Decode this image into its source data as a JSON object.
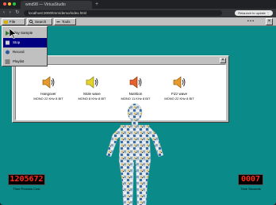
{
  "browser": {
    "tab_title": "wind98 — VirtuaStudio",
    "new_tab": "+",
    "nav": "‹ › ↻",
    "url": "localhost:3000/tmm/demo/index.html",
    "relaunch_label": "Relaunch to update ⋮",
    "window_dots": [
      "#ff5f57",
      "#febc2e",
      "#28c840"
    ]
  },
  "toolbar": {
    "items": [
      {
        "label": "File"
      },
      {
        "label": "Search"
      },
      {
        "label": "Tools"
      }
    ],
    "dots": "• • •",
    "close": "×"
  },
  "menu": {
    "items": [
      {
        "label": "Play Sample",
        "selected": false
      },
      {
        "label": "Stop",
        "selected": true
      },
      {
        "label": "Record",
        "selected": false
      },
      {
        "label": "Playlist",
        "selected": false
      }
    ]
  },
  "dialog": {
    "close": "×",
    "sounds": [
      {
        "name": "Hangover",
        "meta": "MONO 22 KHz  8 BIT",
        "color": "#e69a2c"
      },
      {
        "name": "Mole wave",
        "meta": "MONO 8 KHz  8 BIT",
        "color": "#e6d22c"
      },
      {
        "name": "Nutrition",
        "meta": "MONO 11 KHz  8 BIT",
        "color": "#e6602c"
      },
      {
        "name": "Fizz wave",
        "meta": "MONO 22 KHz  8 BIT",
        "color": "#e69a2c"
      }
    ]
  },
  "counters": {
    "left": {
      "value": "1205672",
      "label": "Time Process Cost"
    },
    "right": {
      "value": "0007",
      "label": "Time Seconds"
    }
  },
  "colors": {
    "desktop": "#0a8a88",
    "led": "#ff2a1a",
    "selection": "#000080"
  }
}
